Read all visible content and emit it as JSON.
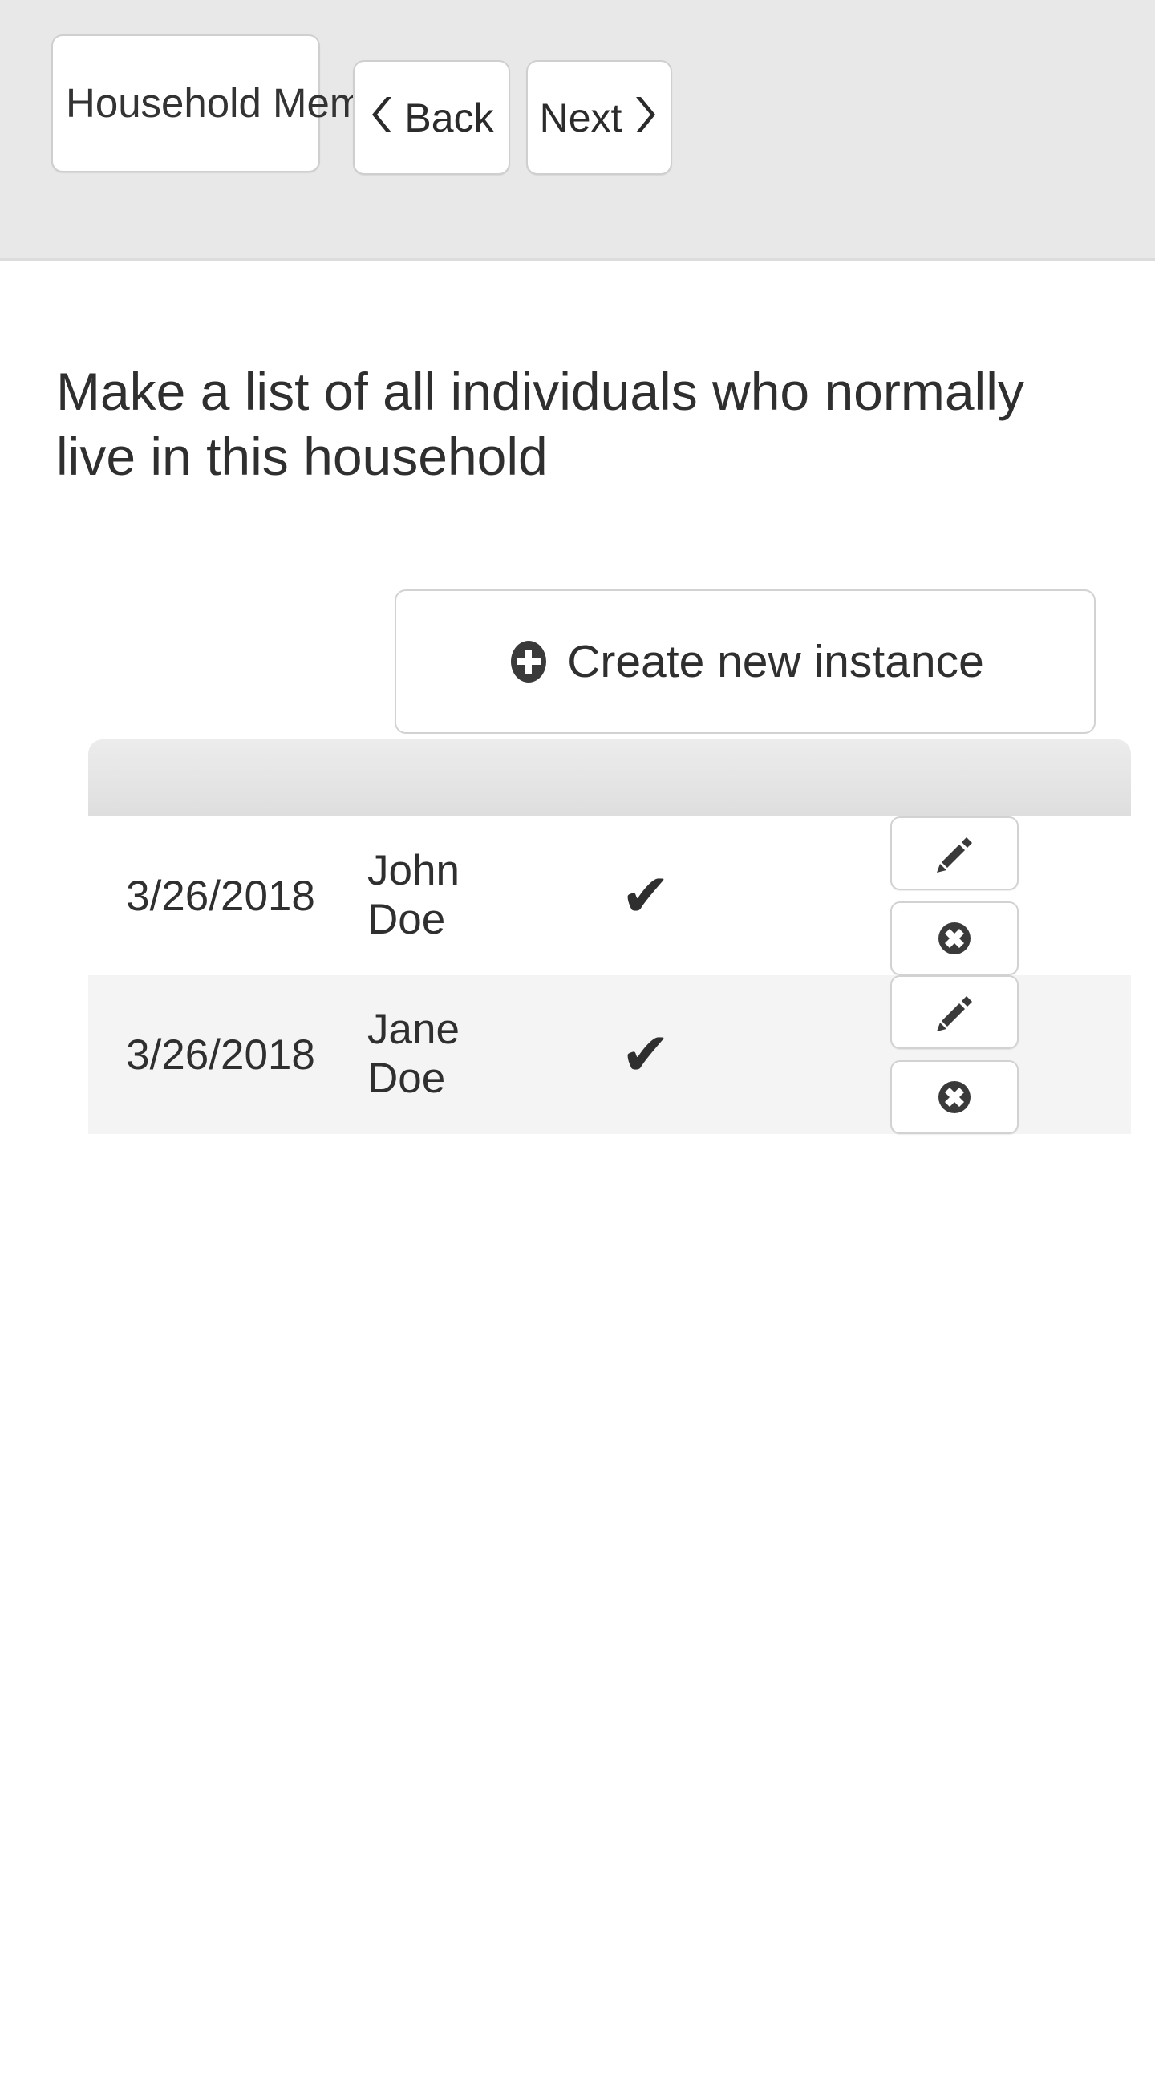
{
  "header": {
    "title_label": "Household Members",
    "back_label": "Back",
    "next_label": "Next",
    "back_icon": "chevron-left-icon",
    "next_icon": "chevron-right-icon",
    "chevron_left_glyph": "‹",
    "chevron_right_glyph": "›"
  },
  "main": {
    "question": "Make a list of all individuals who normally live in this household",
    "create_button": {
      "label": "Create new instance",
      "icon": "plus-circle-icon"
    },
    "table": {
      "columns": [
        "",
        "",
        "",
        ""
      ],
      "rows": [
        {
          "date": "3/26/2018",
          "name": "John Doe",
          "status": "✔",
          "edit_icon": "pencil-icon",
          "delete_icon": "circle-x-icon"
        },
        {
          "date": "3/26/2018",
          "name": "Jane Doe",
          "status": "✔",
          "edit_icon": "pencil-icon",
          "delete_icon": "circle-x-icon"
        }
      ]
    }
  },
  "colors": {
    "header_bg": "#e8e8e8",
    "header_divider": "#dcdcdc",
    "page_bg": "#ffffff",
    "button_bg": "#ffffff",
    "button_border": "#cfcfcf",
    "text": "#2f2f2f",
    "row_stripe": "#f4f4f4",
    "table_head_top": "#ececec",
    "table_head_bottom": "#dedede",
    "icon": "#3a3a3a"
  }
}
